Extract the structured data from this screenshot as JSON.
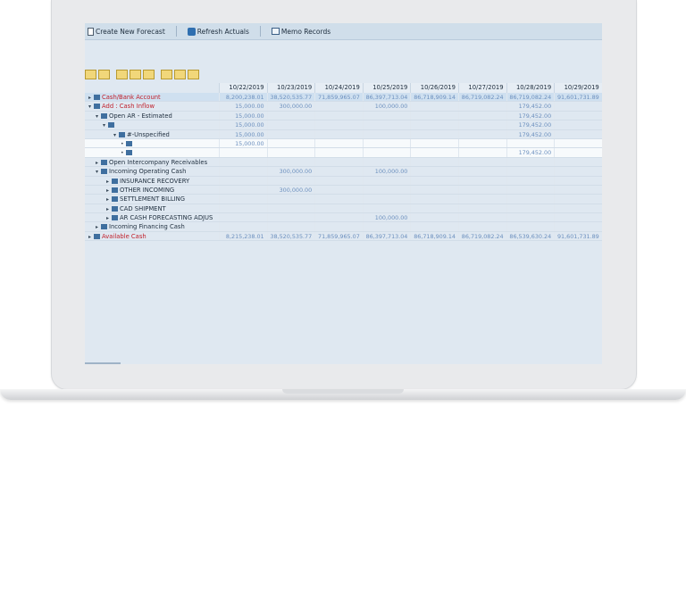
{
  "toolbar": {
    "create_label": "Create New Forecast",
    "refresh_label": "Refresh Actuals",
    "memo_label": "Memo Records"
  },
  "dates": [
    "10/22/2019",
    "10/23/2019",
    "10/24/2019",
    "10/25/2019",
    "10/26/2019",
    "10/27/2019",
    "10/28/2019",
    "10/29/2019"
  ],
  "tree": [
    {
      "label": "Cash/Bank Account",
      "style": "red sel",
      "indent": 0,
      "expander": "▸"
    },
    {
      "label": "Add : Cash Inflow",
      "style": "red",
      "indent": 0,
      "expander": "▾"
    },
    {
      "label": "Open AR - Estimated",
      "style": "",
      "indent": 8,
      "expander": "▾"
    },
    {
      "label": "",
      "style": "",
      "indent": 16,
      "expander": "▾"
    },
    {
      "label": "#-Unspecified",
      "style": "",
      "indent": 28,
      "expander": "▾"
    },
    {
      "label": "",
      "style": "white",
      "indent": 36,
      "expander": "•"
    },
    {
      "label": "",
      "style": "white",
      "indent": 36,
      "expander": "•"
    },
    {
      "label": "Open Intercompany Receivables",
      "style": "",
      "indent": 8,
      "expander": "▸"
    },
    {
      "label": "Incoming Operating Cash",
      "style": "",
      "indent": 8,
      "expander": "▾"
    },
    {
      "label": "INSURANCE RECOVERY",
      "style": "",
      "indent": 20,
      "expander": "▸"
    },
    {
      "label": "OTHER INCOMING",
      "style": "",
      "indent": 20,
      "expander": "▸"
    },
    {
      "label": "SETTLEMENT BILLING",
      "style": "",
      "indent": 20,
      "expander": "▸"
    },
    {
      "label": "CAD SHIPMENT",
      "style": "",
      "indent": 20,
      "expander": "▸"
    },
    {
      "label": "AR CASH FORECASTING ADJUS",
      "style": "",
      "indent": 20,
      "expander": "▸"
    },
    {
      "label": "Incoming Financing Cash",
      "style": "",
      "indent": 8,
      "expander": "▸"
    },
    {
      "label": "Available Cash",
      "style": "red",
      "indent": 0,
      "expander": "▸"
    }
  ],
  "values": [
    {
      "style": "sel",
      "cells": [
        "8,200,238.01",
        "38,520,535.77",
        "71,859,965.07",
        "86,397,713.04",
        "86,718,909.14",
        "86,719,082.24",
        "86,719,082.24",
        "91,601,731.89"
      ]
    },
    {
      "style": "",
      "cells": [
        "15,000.00",
        "300,000.00",
        "",
        "100,000.00",
        "",
        "",
        "179,452.00",
        ""
      ]
    },
    {
      "style": "",
      "cells": [
        "15,000.00",
        "",
        "",
        "",
        "",
        "",
        "179,452.00",
        ""
      ]
    },
    {
      "style": "",
      "cells": [
        "15,000.00",
        "",
        "",
        "",
        "",
        "",
        "179,452.00",
        ""
      ]
    },
    {
      "style": "",
      "cells": [
        "15,000.00",
        "",
        "",
        "",
        "",
        "",
        "179,452.00",
        ""
      ]
    },
    {
      "style": "white",
      "cells": [
        "15,000.00",
        "",
        "",
        "",
        "",
        "",
        "",
        ""
      ]
    },
    {
      "style": "white",
      "cells": [
        "",
        "",
        "",
        "",
        "",
        "",
        "179,452.00",
        ""
      ]
    },
    {
      "style": "",
      "cells": [
        "",
        "",
        "",
        "",
        "",
        "",
        "",
        ""
      ]
    },
    {
      "style": "",
      "cells": [
        "",
        "300,000.00",
        "",
        "100,000.00",
        "",
        "",
        "",
        ""
      ]
    },
    {
      "style": "",
      "cells": [
        "",
        "",
        "",
        "",
        "",
        "",
        "",
        ""
      ]
    },
    {
      "style": "",
      "cells": [
        "",
        "300,000.00",
        "",
        "",
        "",
        "",
        "",
        ""
      ]
    },
    {
      "style": "",
      "cells": [
        "",
        "",
        "",
        "",
        "",
        "",
        "",
        ""
      ]
    },
    {
      "style": "",
      "cells": [
        "",
        "",
        "",
        "",
        "",
        "",
        "",
        ""
      ]
    },
    {
      "style": "",
      "cells": [
        "",
        "",
        "",
        "100,000.00",
        "",
        "",
        "",
        ""
      ]
    },
    {
      "style": "",
      "cells": [
        "",
        "",
        "",
        "",
        "",
        "",
        "",
        ""
      ]
    },
    {
      "style": "",
      "cells": [
        "8,215,238.01",
        "38,520,535.77",
        "71,859,965.07",
        "86,397,713.04",
        "86,718,909.14",
        "86,719,082.24",
        "86,539,630.24",
        "91,601,731.89"
      ]
    }
  ]
}
